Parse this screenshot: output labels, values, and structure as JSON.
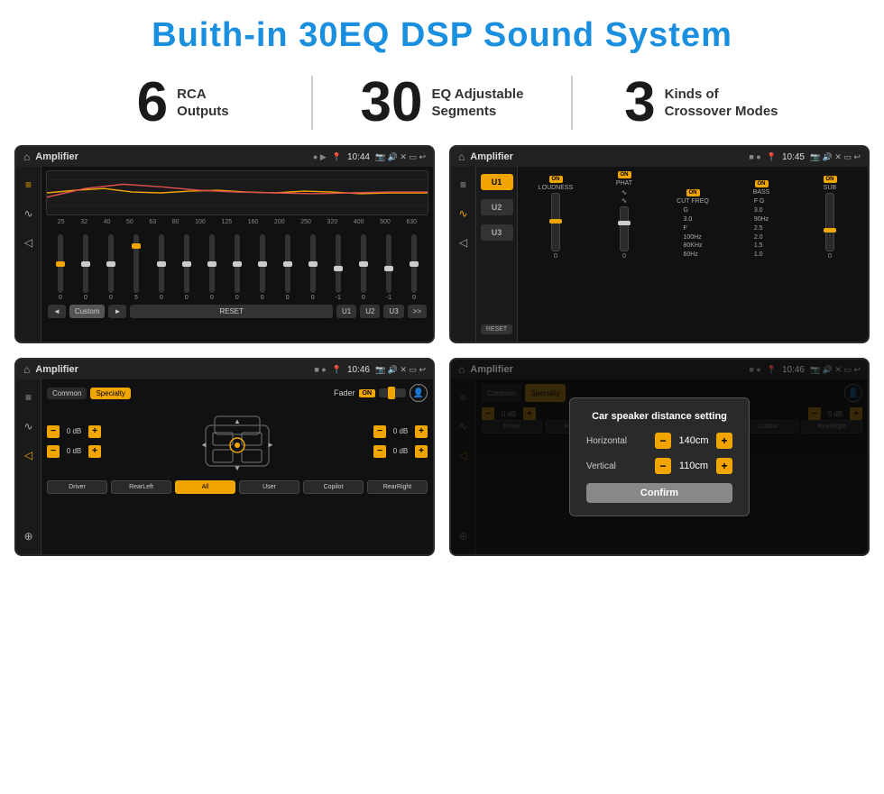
{
  "page": {
    "title": "Buith-in 30EQ DSP Sound System"
  },
  "stats": [
    {
      "number": "6",
      "label_line1": "RCA",
      "label_line2": "Outputs"
    },
    {
      "number": "30",
      "label_line1": "EQ Adjustable",
      "label_line2": "Segments"
    },
    {
      "number": "3",
      "label_line1": "Kinds of",
      "label_line2": "Crossover Modes"
    }
  ],
  "screens": {
    "screen1": {
      "status_title": "Amplifier",
      "time": "10:44",
      "preset": "Custom",
      "buttons": [
        "◄",
        "Custom",
        "►",
        "RESET",
        "U1",
        "U2",
        "U3"
      ],
      "freq_labels": [
        "25",
        "32",
        "40",
        "50",
        "63",
        "80",
        "100",
        "125",
        "160",
        "200",
        "250",
        "320",
        "400",
        "500",
        "630"
      ],
      "slider_values": [
        "0",
        "0",
        "0",
        "5",
        "0",
        "0",
        "0",
        "0",
        "0",
        "0",
        "0",
        "-1",
        "0",
        "-1"
      ]
    },
    "screen2": {
      "status_title": "Amplifier",
      "time": "10:45",
      "u_presets": [
        "U1",
        "U2",
        "U3"
      ],
      "channels": [
        {
          "id": "LOUDNESS",
          "on": true
        },
        {
          "id": "PHAT",
          "on": true
        },
        {
          "id": "CUT FREQ",
          "on": true
        },
        {
          "id": "BASS",
          "on": true
        },
        {
          "id": "SUB",
          "on": true
        }
      ],
      "reset_label": "RESET"
    },
    "screen3": {
      "status_title": "Amplifier",
      "time": "10:46",
      "tabs": [
        "Common",
        "Specialty"
      ],
      "fader_label": "Fader",
      "fader_on": "ON",
      "db_values": [
        "0 dB",
        "0 dB",
        "0 dB",
        "0 dB"
      ],
      "bottom_buttons": [
        "Driver",
        "RearLeft",
        "All",
        "User",
        "Copilot",
        "RearRight"
      ]
    },
    "screen4": {
      "status_title": "Amplifier",
      "time": "10:46",
      "tabs": [
        "Common",
        "Specialty"
      ],
      "dialog": {
        "title": "Car speaker distance setting",
        "horizontal_label": "Horizontal",
        "horizontal_value": "140cm",
        "vertical_label": "Vertical",
        "vertical_value": "110cm",
        "confirm_label": "Confirm"
      },
      "db_values": [
        "0 dB",
        "0 dB"
      ],
      "bottom_buttons": [
        "Driver",
        "RearLeft",
        "All",
        "User",
        "Copilot",
        "RearRight"
      ]
    }
  }
}
